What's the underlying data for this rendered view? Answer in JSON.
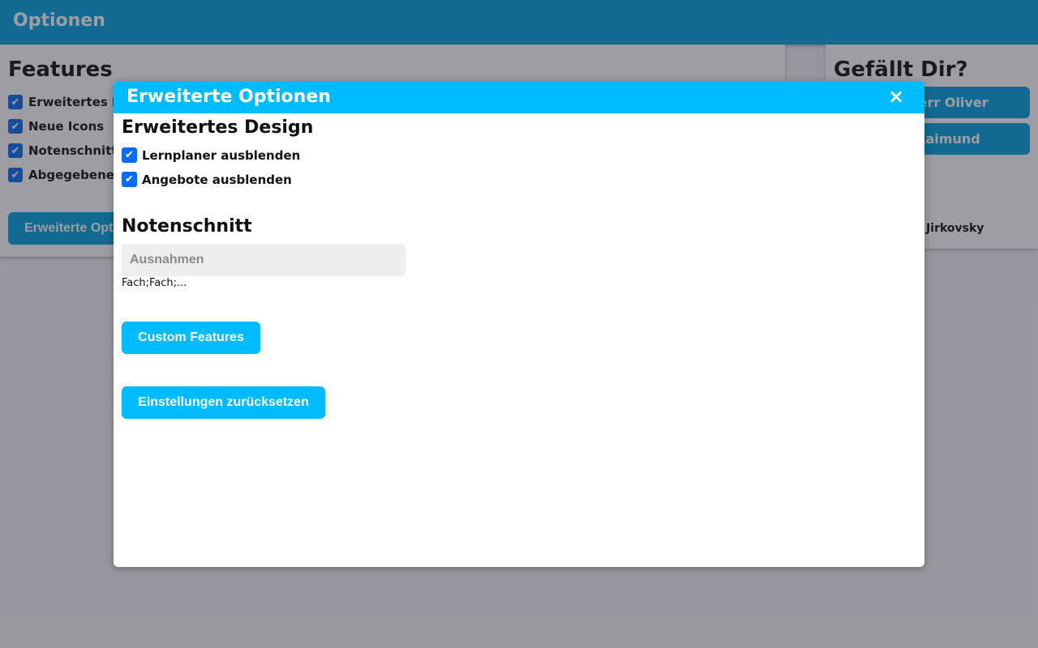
{
  "header": {
    "title": "Optionen"
  },
  "features_card": {
    "title": "Features",
    "items": [
      {
        "label": "Erweitertes Design",
        "checked": true
      },
      {
        "label": "Neue Icons",
        "checked": true
      },
      {
        "label": "Notenschnitt",
        "checked": true
      },
      {
        "label": "Abgegebene Aufgaben",
        "checked": true
      }
    ],
    "advanced_button": "Erweiterte Optionen"
  },
  "like_card": {
    "title": "Gefällt Dir?",
    "button1": "Danke an Herr Oliver",
    "button2": "Danke an Raimund",
    "credit": "Von Kilian Jirkovsky"
  },
  "modal": {
    "title": "Erweiterte Optionen",
    "close_icon": "×",
    "design_section": {
      "title": "Erweitertes Design",
      "options": [
        {
          "label": "Lernplaner ausblenden",
          "checked": true
        },
        {
          "label": "Angebote ausblenden",
          "checked": true
        }
      ]
    },
    "grade_section": {
      "title": "Notenschnitt",
      "exceptions_placeholder": "Ausnahmen",
      "exceptions_value": "",
      "hint": "Fach;Fach;..."
    },
    "custom_features_button": "Custom Features",
    "reset_button": "Einstellungen zurücksetzen"
  },
  "checkmark_glyph": "✔"
}
